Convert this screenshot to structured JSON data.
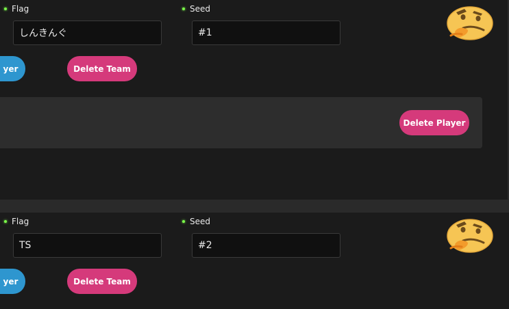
{
  "teams": [
    {
      "flag_label": "Flag",
      "seed_label": "Seed",
      "flag_value": "しんきんぐ",
      "seed_value": "#1",
      "add_player_partial": "yer",
      "delete_team_label": "Delete Team",
      "delete_player_label": "Delete Player",
      "avatar_icon": "thinking-emoji-icon"
    },
    {
      "flag_label": "Flag",
      "seed_label": "Seed",
      "flag_value": "TS",
      "seed_value": "#2",
      "add_player_partial": "yer",
      "delete_team_label": "Delete Team",
      "avatar_icon": "thinking-emoji-icon"
    }
  ],
  "colors": {
    "background": "#1b1b1b",
    "panel": "#2d2d2d",
    "input_bg": "#101010",
    "accent_pink": "#d53a7b",
    "accent_blue": "#2e96cf",
    "dot_green": "#7cff4a"
  }
}
